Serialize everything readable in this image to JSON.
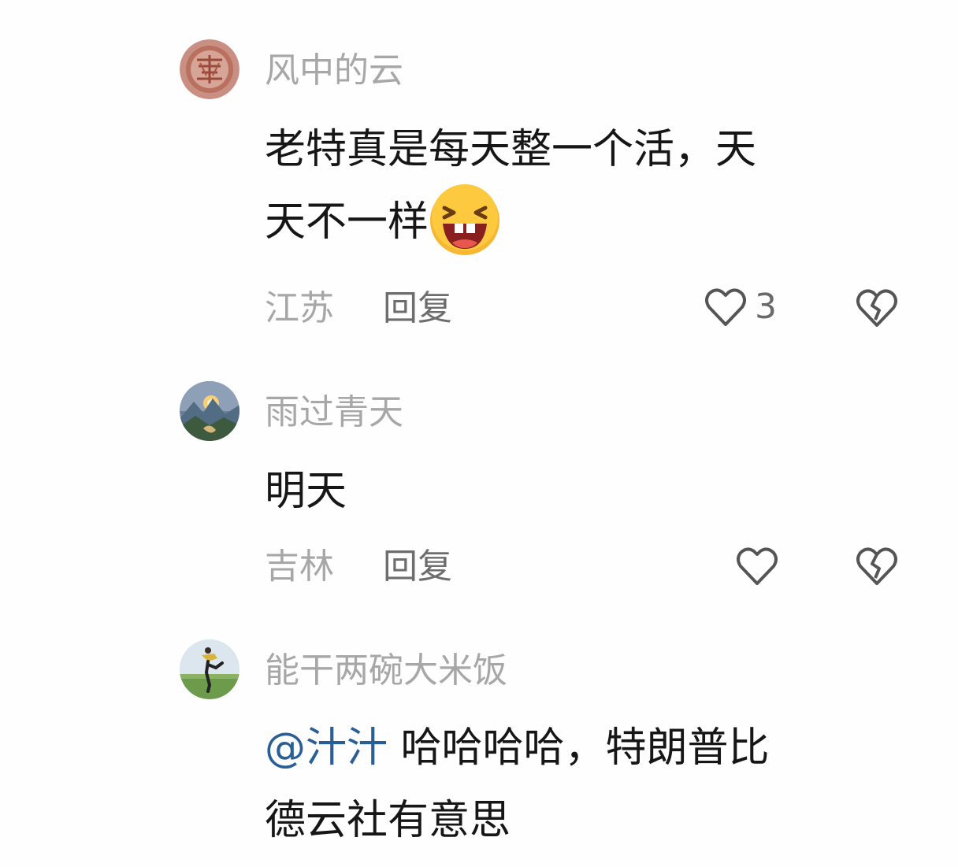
{
  "comments": [
    {
      "username": "风中的云",
      "text_line1": "老特真是每天整一个活，天",
      "text_line2": "天不一样",
      "emoji": "laughing-face-emoji",
      "location": "江苏",
      "reply_label": "回复",
      "like_count": "3",
      "avatar_icon": "red-seal-avatar"
    },
    {
      "username": "雨过青天",
      "text_line1": "明天",
      "location": "吉林",
      "reply_label": "回复",
      "like_count": "",
      "avatar_icon": "mountain-landscape-avatar"
    },
    {
      "username": "能干两碗大米饭",
      "mention": "@汁汁",
      "text_line1": " 哈哈哈哈，特朗普比",
      "text_line2": "德云社有意思",
      "avatar_icon": "kicking-person-avatar"
    }
  ],
  "icons": {
    "like": "heart-outline-icon",
    "dislike": "broken-heart-icon"
  },
  "colors": {
    "username": "#a7a7a7",
    "body": "#161616",
    "mention": "#2a5f95",
    "reply": "#6d6d6d"
  }
}
